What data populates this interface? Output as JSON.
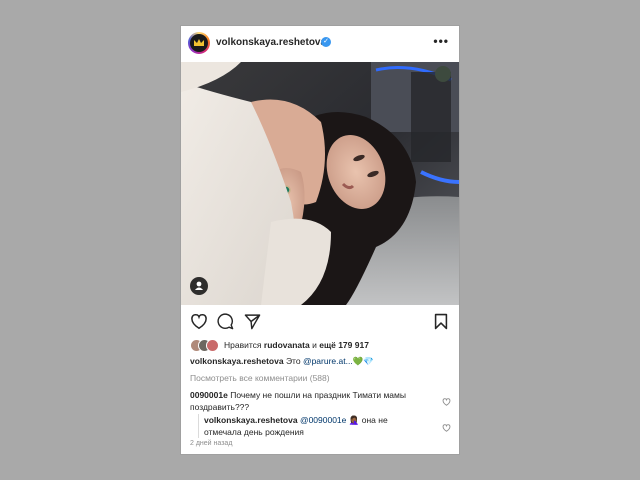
{
  "post": {
    "username": "volkonskaya.reshetova",
    "verified_icon": "verified-badge-icon",
    "more_icon": "more-options-icon",
    "more_label": "•••"
  },
  "actions": {
    "like_icon": "heart-icon",
    "comment_icon": "comment-icon",
    "share_icon": "share-icon",
    "save_icon": "bookmark-icon"
  },
  "likes": {
    "prefix": "Нравится",
    "user": "rudovanata",
    "joiner": "и",
    "others": "ещё 179 917"
  },
  "caption": {
    "username": "volkonskaya.reshetova",
    "text": "Это",
    "mention": "@parure.at...",
    "emoji_1": "💚",
    "emoji_2": "💎"
  },
  "view_all_comments": "Посмотреть все комментарии (588)",
  "comments": [
    {
      "username": "0090001e",
      "text": "Почему не пошли на праздник Тимати мамы поздравить???"
    }
  ],
  "reply": {
    "username": "volkonskaya.reshetova",
    "mention": "@0090001e",
    "emoji": "🤦🏾‍♀️",
    "text": "она не отмечала день рождения"
  },
  "timestamp": "2 дней назад",
  "colors": {
    "background": "#a9a9a9",
    "card": "#ffffff",
    "verified": "#3897f0",
    "mention": "#00376b",
    "muted": "#8e8e8e"
  }
}
